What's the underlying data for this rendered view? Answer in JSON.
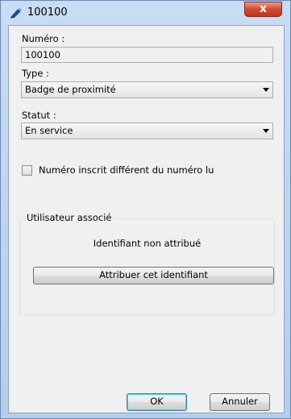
{
  "window": {
    "title": "100100",
    "close_label": "x"
  },
  "form": {
    "numero_label": "Numéro :",
    "numero_value": "100100",
    "type_label": "Type :",
    "type_value": "Badge de proximité",
    "statut_label": "Statut :",
    "statut_value": "En service",
    "checkbox_label": "Numéro inscrit différent du numéro lu",
    "checkbox_checked": false
  },
  "user_group": {
    "title": "Utilisateur associé",
    "status_text": "Identifiant non attribué",
    "assign_button": "Attribuer cet identifiant"
  },
  "footer": {
    "ok_label": "OK",
    "cancel_label": "Annuler"
  }
}
